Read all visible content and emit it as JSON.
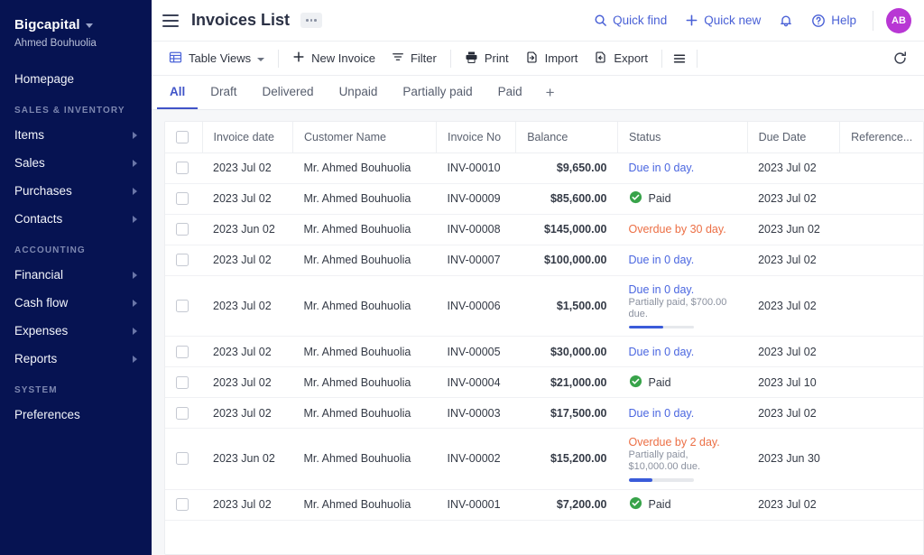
{
  "sidebar": {
    "brand": "Bigcapital",
    "user": "Ahmed Bouhuolia",
    "items": [
      {
        "label": "Homepage",
        "arrow": false,
        "type": "item"
      },
      {
        "label": "SALES & INVENTORY",
        "type": "group"
      },
      {
        "label": "Items",
        "arrow": true,
        "type": "item"
      },
      {
        "label": "Sales",
        "arrow": true,
        "type": "item"
      },
      {
        "label": "Purchases",
        "arrow": true,
        "type": "item"
      },
      {
        "label": "Contacts",
        "arrow": true,
        "type": "item"
      },
      {
        "label": "ACCOUNTING",
        "type": "group"
      },
      {
        "label": "Financial",
        "arrow": true,
        "type": "item"
      },
      {
        "label": "Cash flow",
        "arrow": true,
        "type": "item"
      },
      {
        "label": "Expenses",
        "arrow": true,
        "type": "item"
      },
      {
        "label": "Reports",
        "arrow": true,
        "type": "item"
      },
      {
        "label": "SYSTEM",
        "type": "group"
      },
      {
        "label": "Preferences",
        "arrow": false,
        "type": "item"
      }
    ]
  },
  "topbar": {
    "title": "Invoices List",
    "quick_find": "Quick find",
    "quick_new": "Quick new",
    "help": "Help",
    "avatar_initials": "AB"
  },
  "toolbar": {
    "table_views": "Table Views",
    "new_invoice": "New Invoice",
    "filter": "Filter",
    "print": "Print",
    "import": "Import",
    "export": "Export"
  },
  "tabs": {
    "items": [
      "All",
      "Draft",
      "Delivered",
      "Unpaid",
      "Partially paid",
      "Paid"
    ],
    "active_index": 0,
    "add_label": "+"
  },
  "table": {
    "columns": [
      "Invoice date",
      "Customer Name",
      "Invoice No",
      "Balance",
      "Status",
      "Due Date",
      "Reference..."
    ],
    "rows": [
      {
        "invoice_date": "2023 Jul 02",
        "customer": "Mr. Ahmed Bouhuolia",
        "invoice_no": "INV-00010",
        "balance": "$9,650.00",
        "status_kind": "due",
        "status_text": "Due in 0 day.",
        "status_sub": "",
        "progress": null,
        "due_date": "2023 Jul 02",
        "reference": ""
      },
      {
        "invoice_date": "2023 Jul 02",
        "customer": "Mr. Ahmed Bouhuolia",
        "invoice_no": "INV-00009",
        "balance": "$85,600.00",
        "status_kind": "paid",
        "status_text": "Paid",
        "status_sub": "",
        "progress": null,
        "due_date": "2023 Jul 02",
        "reference": ""
      },
      {
        "invoice_date": "2023 Jun 02",
        "customer": "Mr. Ahmed Bouhuolia",
        "invoice_no": "INV-00008",
        "balance": "$145,000.00",
        "status_kind": "overdue",
        "status_text": "Overdue by 30 day.",
        "status_sub": "",
        "progress": null,
        "due_date": "2023 Jun 02",
        "reference": ""
      },
      {
        "invoice_date": "2023 Jul 02",
        "customer": "Mr. Ahmed Bouhuolia",
        "invoice_no": "INV-00007",
        "balance": "$100,000.00",
        "status_kind": "due",
        "status_text": "Due in 0 day.",
        "status_sub": "",
        "progress": null,
        "due_date": "2023 Jul 02",
        "reference": ""
      },
      {
        "invoice_date": "2023 Jul 02",
        "customer": "Mr. Ahmed Bouhuolia",
        "invoice_no": "INV-00006",
        "balance": "$1,500.00",
        "status_kind": "due",
        "status_text": "Due in 0 day.",
        "status_sub": "Partially paid, $700.00 due.",
        "progress": 53,
        "due_date": "2023 Jul 02",
        "reference": ""
      },
      {
        "invoice_date": "2023 Jul 02",
        "customer": "Mr. Ahmed Bouhuolia",
        "invoice_no": "INV-00005",
        "balance": "$30,000.00",
        "status_kind": "due",
        "status_text": "Due in 0 day.",
        "status_sub": "",
        "progress": null,
        "due_date": "2023 Jul 02",
        "reference": ""
      },
      {
        "invoice_date": "2023 Jul 02",
        "customer": "Mr. Ahmed Bouhuolia",
        "invoice_no": "INV-00004",
        "balance": "$21,000.00",
        "status_kind": "paid",
        "status_text": "Paid",
        "status_sub": "",
        "progress": null,
        "due_date": "2023 Jul 10",
        "reference": ""
      },
      {
        "invoice_date": "2023 Jul 02",
        "customer": "Mr. Ahmed Bouhuolia",
        "invoice_no": "INV-00003",
        "balance": "$17,500.00",
        "status_kind": "due",
        "status_text": "Due in 0 day.",
        "status_sub": "",
        "progress": null,
        "due_date": "2023 Jul 02",
        "reference": ""
      },
      {
        "invoice_date": "2023 Jun 02",
        "customer": "Mr. Ahmed Bouhuolia",
        "invoice_no": "INV-00002",
        "balance": "$15,200.00",
        "status_kind": "overdue",
        "status_text": "Overdue by 2 day.",
        "status_sub": "Partially paid, $10,000.00 due.",
        "progress": 37,
        "due_date": "2023 Jun 30",
        "reference": ""
      },
      {
        "invoice_date": "2023 Jul 02",
        "customer": "Mr. Ahmed Bouhuolia",
        "invoice_no": "INV-00001",
        "balance": "$7,200.00",
        "status_kind": "paid",
        "status_text": "Paid",
        "status_sub": "",
        "progress": null,
        "due_date": "2023 Jul 02",
        "reference": ""
      }
    ]
  },
  "colors": {
    "sidebar_bg": "#061352",
    "accent": "#4054c8",
    "paid_green": "#38a34a",
    "overdue_orange": "#ec6f45",
    "due_blue": "#4a66e0",
    "avatar": "#b837d4"
  }
}
